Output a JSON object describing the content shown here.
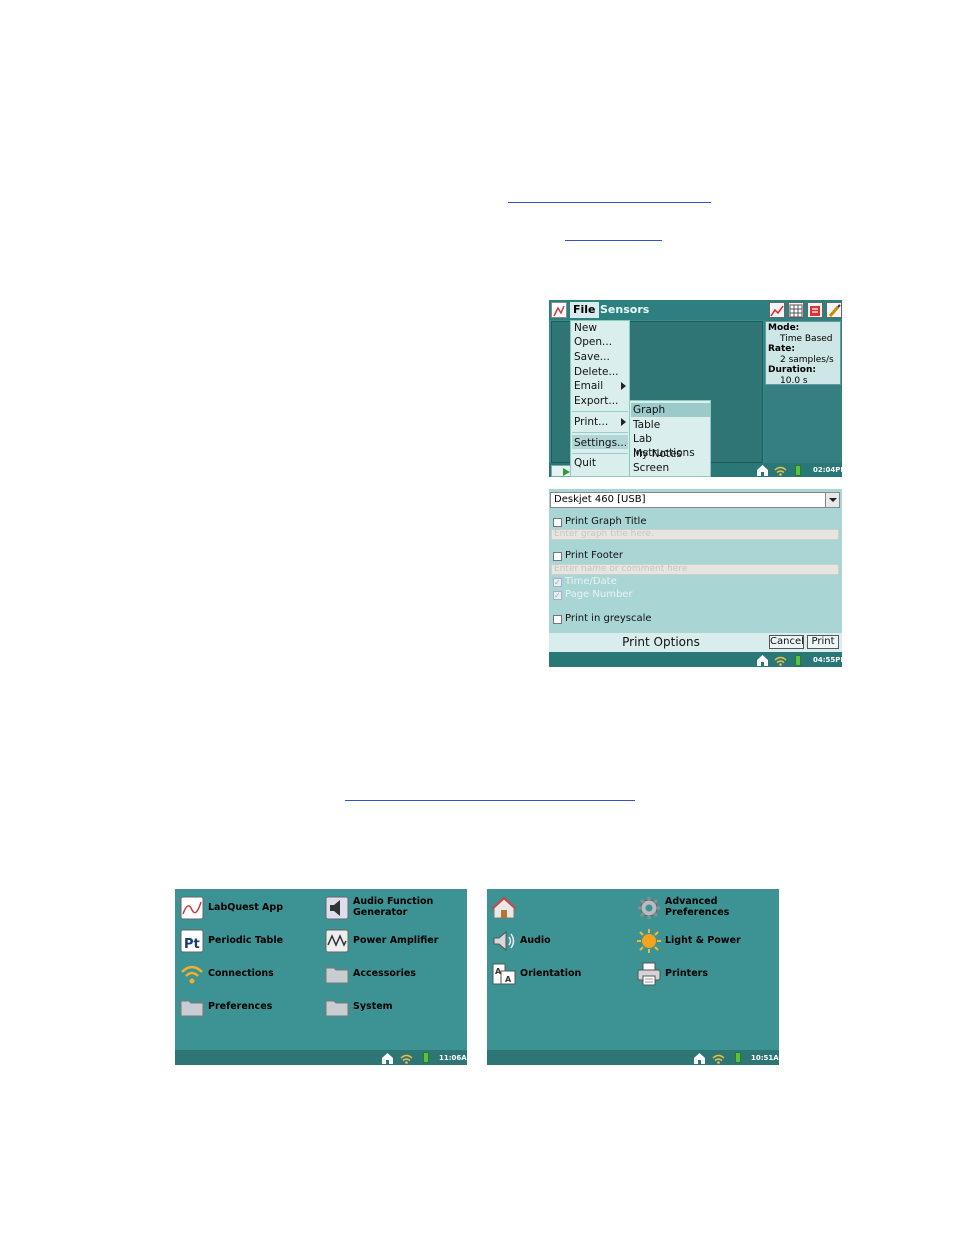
{
  "screen_file_menu": {
    "menu_file": "File",
    "menu_sensors": "Sensors",
    "file_items": [
      "New",
      "Open...",
      "Save...",
      "Delete...",
      "Email",
      "Export...",
      "Print...",
      "Settings...",
      "Quit"
    ],
    "print_submenu": [
      "Graph",
      "Table",
      "Lab Instructions",
      "My Notes",
      "Screen"
    ],
    "mode_label": "Mode:",
    "mode_value": "Time Based",
    "rate_label": "Rate:",
    "rate_value": "2 samples/s",
    "duration_label": "Duration:",
    "duration_value": "10.0 s",
    "clock": "02:04PM"
  },
  "screen_print_options": {
    "printer": "Deskjet 460 [USB]",
    "print_graph_title": "Print Graph Title",
    "graph_title_placeholder": "Enter graph title here.",
    "print_footer": "Print Footer",
    "footer_placeholder": "Enter name or comment here",
    "time_date": "Time/Date",
    "page_number": "Page Number",
    "greyscale": "Print in greyscale",
    "title": "Print Options",
    "cancel": "Cancel",
    "print": "Print",
    "clock": "04:55PM"
  },
  "screen_home": {
    "tiles": [
      {
        "label": "LabQuest App"
      },
      {
        "label": "Audio Function",
        "label2": "Generator"
      },
      {
        "label": "Periodic Table"
      },
      {
        "label": "Power Amplifier"
      },
      {
        "label": "Connections"
      },
      {
        "label": "Accessories"
      },
      {
        "label": "Preferences"
      },
      {
        "label": "System"
      }
    ],
    "periodic_icon_text": "Pt",
    "clock": "11:06AM"
  },
  "screen_system": {
    "tiles": [
      {
        "label": ""
      },
      {
        "label": "Advanced",
        "label2": "Preferences"
      },
      {
        "label": "Audio"
      },
      {
        "label": "Light & Power"
      },
      {
        "label": "Orientation"
      },
      {
        "label": "Printers"
      }
    ],
    "clock": "10:51AM"
  },
  "colors": {
    "teal": "#3d9293",
    "teal_dark": "#2e7676",
    "link": "#3552c7",
    "battery": "#57c244"
  }
}
